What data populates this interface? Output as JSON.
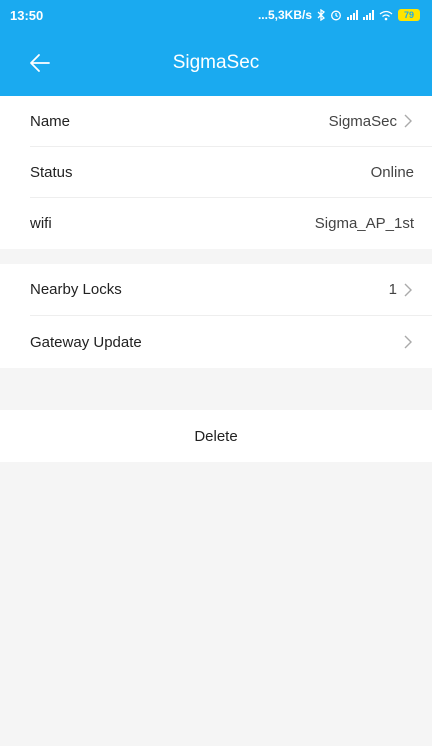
{
  "status_bar": {
    "time": "13:50",
    "net_speed": "...5,3KB/s",
    "battery": "79"
  },
  "nav": {
    "title": "SigmaSec",
    "back_icon": "arrow-left-icon"
  },
  "device_info": [
    {
      "label": "Name",
      "value": "SigmaSec",
      "chevron": true
    },
    {
      "label": "Status",
      "value": "Online",
      "chevron": false
    },
    {
      "label": "wifi",
      "value": "Sigma_AP_1st",
      "chevron": false
    }
  ],
  "actions": [
    {
      "label": "Nearby Locks",
      "value": "1",
      "chevron": true
    },
    {
      "label": "Gateway Update",
      "value": "",
      "chevron": true
    }
  ],
  "delete_label": "Delete",
  "colors": {
    "header": "#1aaaf0",
    "background": "#f5f5f5",
    "battery": "#ffe400"
  }
}
